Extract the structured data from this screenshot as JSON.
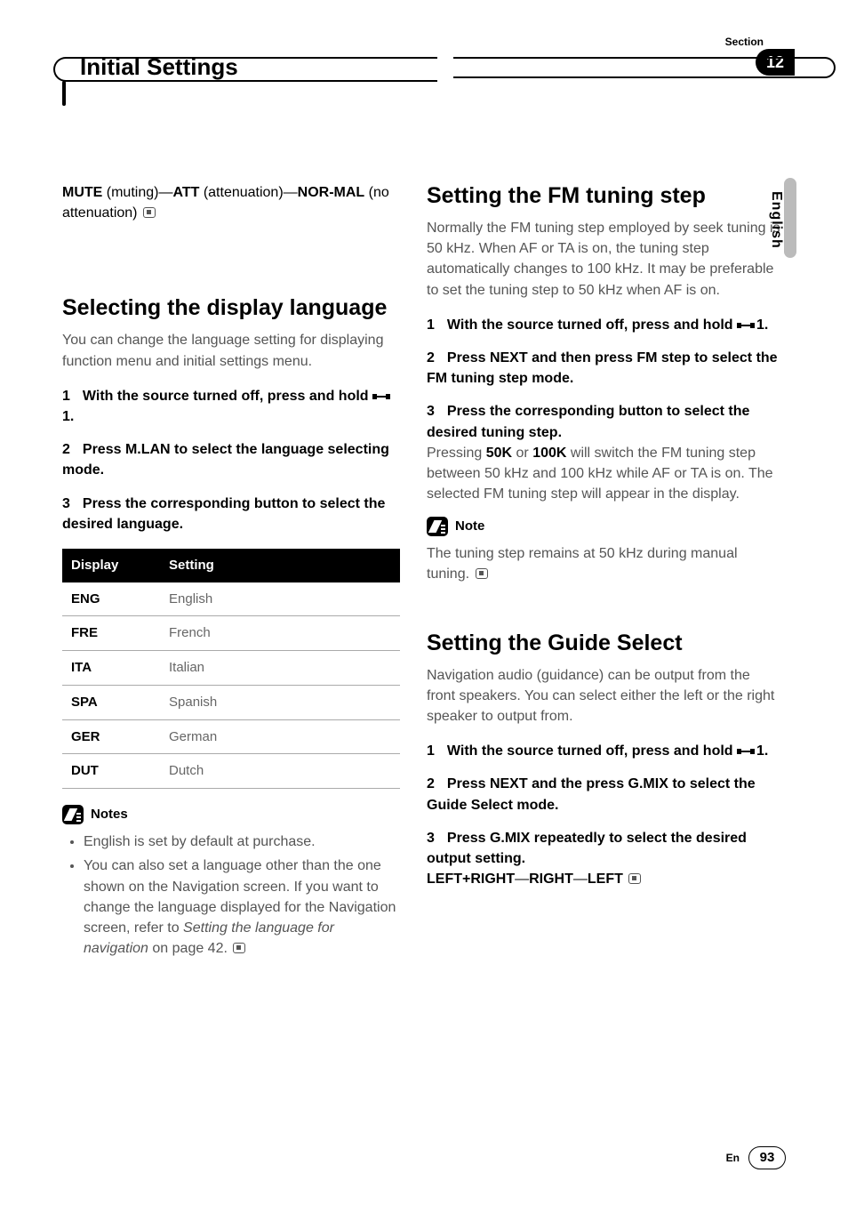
{
  "header": {
    "section_label": "Section",
    "section_number": "12",
    "title": "Initial Settings"
  },
  "side": {
    "language": "English"
  },
  "left_col": {
    "mute_options": {
      "opt1": "MUTE",
      "opt1_desc": " (muting)",
      "sep": "—",
      "opt2": "ATT",
      "opt2_desc": " (attenuation)",
      "opt3": "NOR-MAL",
      "opt3_desc": " (no attenuation)"
    },
    "lang_heading": "Selecting the display language",
    "lang_intro": "You can change the language setting for displaying function menu and initial settings menu.",
    "steps": {
      "s1_num": "1",
      "s1_lead_a": "With the source turned off, press and hold ",
      "s1_lead_b": "1.",
      "s2_num": "2",
      "s2_lead": "Press M.LAN to select the language selecting mode.",
      "s3_num": "3",
      "s3_lead": "Press the corresponding button to select the desired language."
    },
    "table": {
      "h1": "Display",
      "h2": "Setting",
      "rows": [
        {
          "code": "ENG",
          "val": "English"
        },
        {
          "code": "FRE",
          "val": "French"
        },
        {
          "code": "ITA",
          "val": "Italian"
        },
        {
          "code": "SPA",
          "val": "Spanish"
        },
        {
          "code": "GER",
          "val": "German"
        },
        {
          "code": "DUT",
          "val": "Dutch"
        }
      ]
    },
    "notes_heading": "Notes",
    "notes": {
      "n1": "English is set by default at purchase.",
      "n2a": "You can also set a language other than the one shown on the Navigation screen. If you want to change the language displayed for the Navigation screen, refer to ",
      "n2i": "Setting the language for navigation",
      "n2b": " on page 42."
    }
  },
  "right_col": {
    "fm_heading": "Setting the FM tuning step",
    "fm_intro": "Normally the FM tuning step employed by seek tuning is 50 kHz. When AF or TA is on, the tuning step automatically changes to 100 kHz. It may be preferable to set the tuning step to 50 kHz when AF is on.",
    "fm_steps": {
      "s1_num": "1",
      "s1_lead_a": "With the source turned off, press and hold ",
      "s1_lead_b": "1.",
      "s2_num": "2",
      "s2_lead": "Press NEXT and then press FM step to select the FM tuning step mode.",
      "s3_num": "3",
      "s3_lead": "Press the corresponding button to select the desired tuning step.",
      "s3_body_a": "Pressing ",
      "s3_body_b1": "50K",
      "s3_body_mid": " or ",
      "s3_body_b2": "100K",
      "s3_body_c": " will switch the FM tuning step between 50 kHz and 100 kHz while AF or TA is on. The selected FM tuning step will appear in the display."
    },
    "fm_note_heading": "Note",
    "fm_note": "The tuning step remains at 50 kHz during manual tuning.",
    "gs_heading": "Setting the Guide Select",
    "gs_intro": "Navigation audio (guidance) can be output from the front speakers. You can select either the left or the right speaker to output from.",
    "gs_steps": {
      "s1_num": "1",
      "s1_lead_a": "With the source turned off, press and hold ",
      "s1_lead_b": "1.",
      "s2_num": "2",
      "s2_lead": "Press NEXT and the press G.MIX to select the Guide Select mode.",
      "s3_num": "3",
      "s3_lead": "Press G.MIX repeatedly to select the desired output setting.",
      "s3_opts_a": "LEFT+RIGHT",
      "s3_sep": "—",
      "s3_opts_b": "RIGHT",
      "s3_opts_c": "LEFT"
    }
  },
  "footer": {
    "lang_code": "En",
    "page": "93"
  }
}
